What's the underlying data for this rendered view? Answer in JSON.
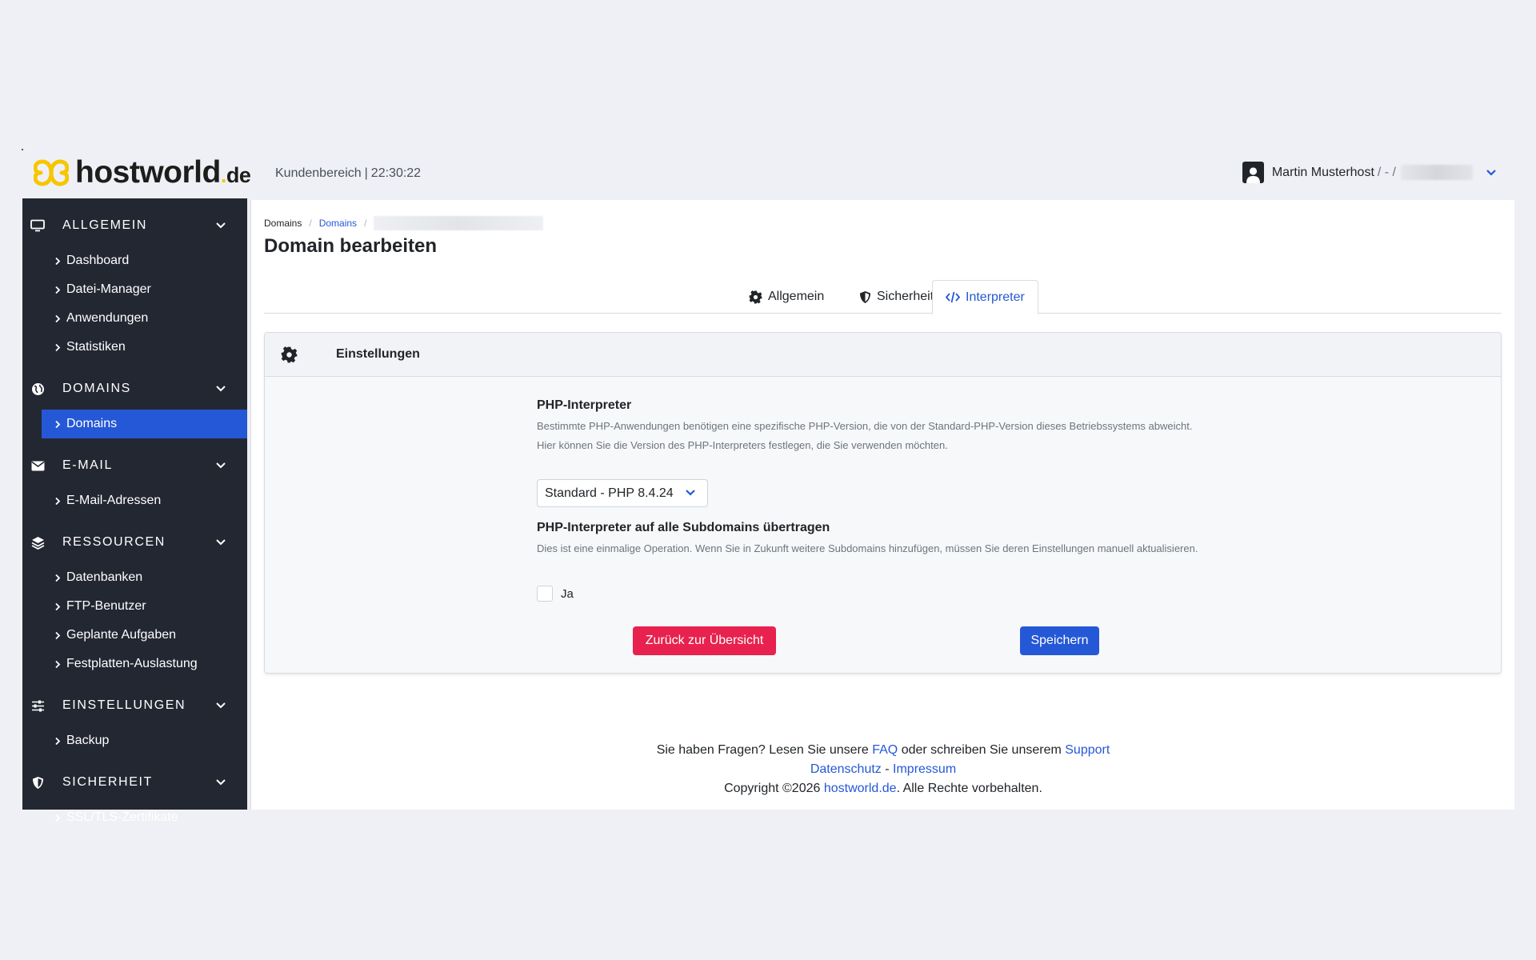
{
  "header": {
    "brand": "hostworld",
    "brand_dot": ".",
    "brand_tld": "de",
    "area": "Kundenbereich",
    "time": "22:30:22",
    "user_name": "Martin Musterhost",
    "user_suffix": "/ - /"
  },
  "sidebar": {
    "sections": [
      {
        "title": "ALLGEMEIN",
        "icon": "monitor-icon",
        "items": [
          "Dashboard",
          "Datei-Manager",
          "Anwendungen",
          "Statistiken"
        ]
      },
      {
        "title": "DOMAINS",
        "icon": "globe-icon",
        "items": [
          "Domains"
        ],
        "active_item": "Domains"
      },
      {
        "title": "E-MAIL",
        "icon": "envelope-icon",
        "items": [
          "E-Mail-Adressen"
        ]
      },
      {
        "title": "RESSOURCEN",
        "icon": "layers-icon",
        "items": [
          "Datenbanken",
          "FTP-Benutzer",
          "Geplante Aufgaben",
          "Festplatten-Auslastung"
        ]
      },
      {
        "title": "EINSTELLUNGEN",
        "icon": "sliders-icon",
        "items": [
          "Backup"
        ]
      },
      {
        "title": "SICHERHEIT",
        "icon": "shield-icon",
        "items": [
          "SSL/TLS-Zertifikate"
        ]
      }
    ]
  },
  "breadcrumb": {
    "first": "Domains",
    "second": "Domains",
    "sep": "/"
  },
  "page_title": "Domain bearbeiten",
  "tabs": [
    {
      "label": "Allgemein",
      "icon": "gear-icon"
    },
    {
      "label": "Sicherheit",
      "icon": "shield-icon"
    },
    {
      "label": "Interpreter",
      "icon": "code-icon",
      "active": true
    }
  ],
  "card": {
    "title": "Einstellungen",
    "php_label": "PHP-Interpreter",
    "php_help_1": "Bestimmte PHP-Anwendungen benötigen eine spezifische PHP-Version, die von der Standard-PHP-Version dieses Betriebssystems abweicht.",
    "php_help_2": "Hier können Sie die Version des PHP-Interpreters festlegen, die Sie verwenden möchten.",
    "php_select_value": "Standard - PHP 8.4.24",
    "sub_label": "PHP-Interpreter auf alle Subdomains übertragen",
    "sub_help": "Dies ist eine einmalige Operation. Wenn Sie in Zukunft weitere Subdomains hinzufügen, müssen Sie deren Einstellungen manuell aktualisieren.",
    "checkbox_label": "Ja",
    "checkbox_checked": false,
    "back_button": "Zurück zur Übersicht",
    "save_button": "Speichern"
  },
  "footer": {
    "q_text": "Sie haben Fragen? Lesen Sie unsere",
    "faq": "FAQ",
    "q_mid": "oder schreiben Sie unserem",
    "support": "Support",
    "privacy": "Datenschutz",
    "dash": "-",
    "imprint": "Impressum",
    "copyright": "Copyright ©2026",
    "site": "hostworld.de",
    "rights": ". Alle Rechte vorbehalten."
  },
  "colors": {
    "accent": "#2558d6",
    "danger": "#e8214e",
    "sidebar": "#232732",
    "logo_yellow": "#f7c600"
  }
}
